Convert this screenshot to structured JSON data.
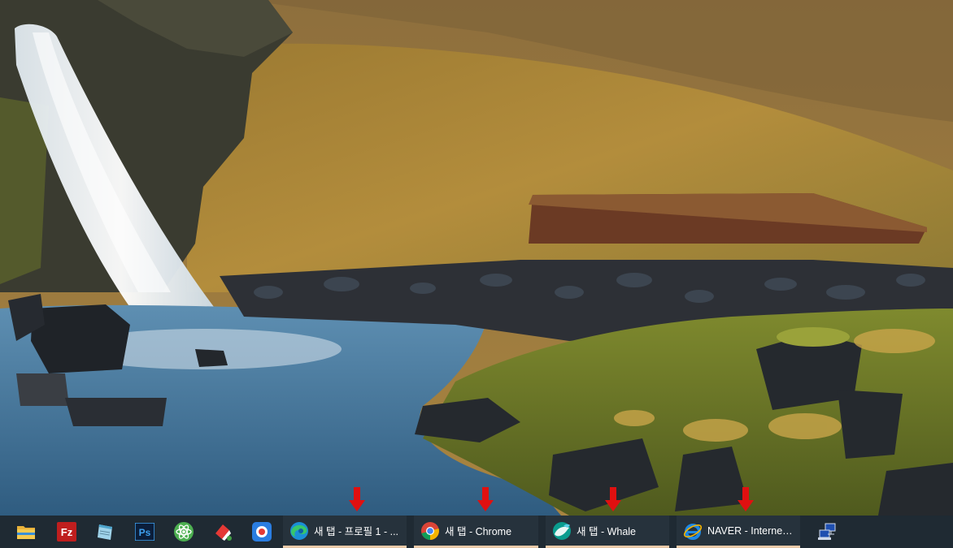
{
  "taskbar": {
    "pinned": [
      {
        "name": "file-explorer-icon"
      },
      {
        "name": "filezilla-icon",
        "glyph": "Fz"
      },
      {
        "name": "notepad-icon"
      },
      {
        "name": "photoshop-icon",
        "glyph": "Ps"
      },
      {
        "name": "atom-icon"
      },
      {
        "name": "pen-app-icon"
      },
      {
        "name": "record-app-icon"
      }
    ],
    "apps": [
      {
        "name": "edge",
        "label": "새 탭 - 프로필 1 - ..."
      },
      {
        "name": "chrome",
        "label": "새 탭 - Chrome"
      },
      {
        "name": "whale",
        "label": "새 탭 - Whale"
      },
      {
        "name": "internet-explorer",
        "label": "NAVER - Internet E..."
      }
    ],
    "tray": {
      "name": "network-icon"
    }
  },
  "colors": {
    "taskbar_bg": "#1f2a33",
    "active_indicator": "#e9c9a8",
    "arrow": "#e01010"
  }
}
